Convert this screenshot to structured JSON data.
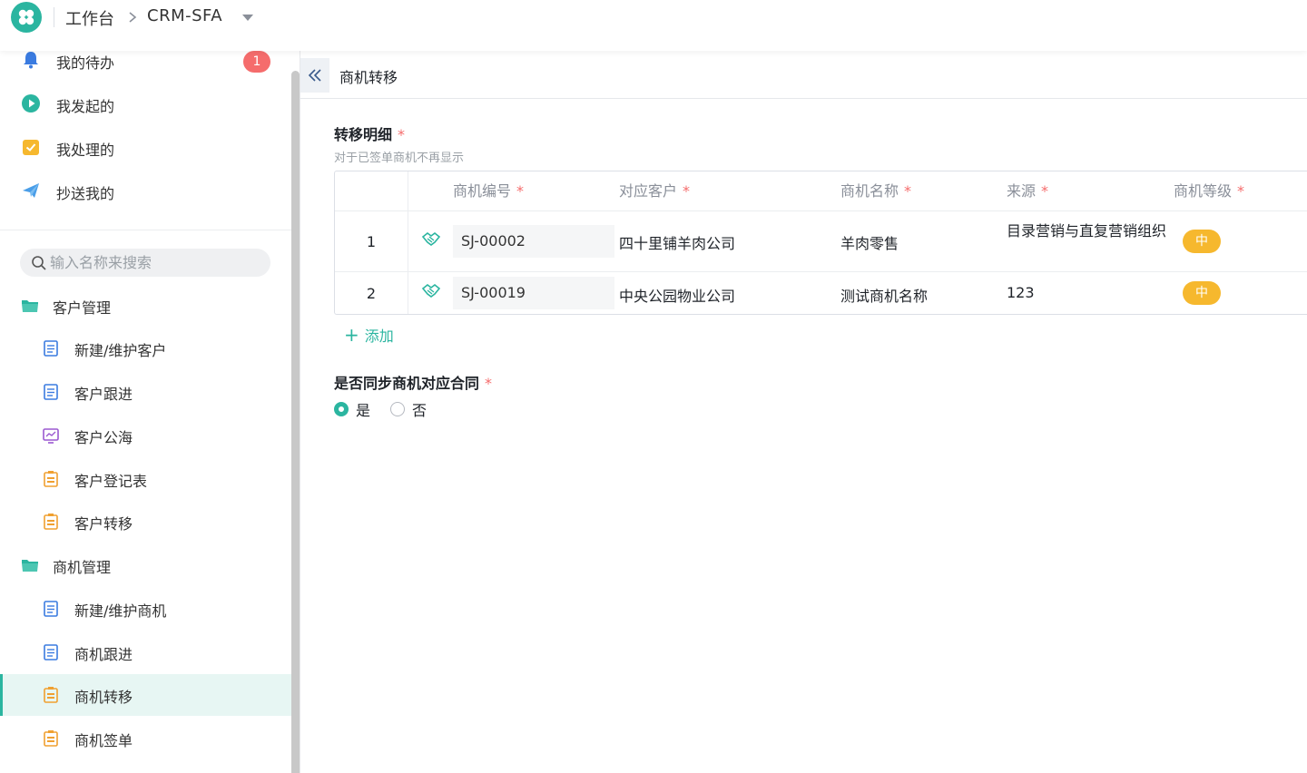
{
  "topbar": {
    "home_label": "工作台",
    "app_label": "CRM-SFA"
  },
  "sidebar": {
    "quick": [
      {
        "label": "我的待办",
        "icon": "bell-icon",
        "badge": "1"
      },
      {
        "label": "我发起的",
        "icon": "play-circle-icon"
      },
      {
        "label": "我处理的",
        "icon": "checklist-icon"
      },
      {
        "label": "抄送我的",
        "icon": "paper-plane-icon"
      }
    ],
    "search_placeholder": "输入名称来搜索",
    "groups": [
      {
        "label": "客户管理",
        "items": [
          {
            "label": "新建/维护客户",
            "icon": "form-icon"
          },
          {
            "label": "客户跟进",
            "icon": "form-icon"
          },
          {
            "label": "客户公海",
            "icon": "dashboard-icon"
          },
          {
            "label": "客户登记表",
            "icon": "report-icon"
          },
          {
            "label": "客户转移",
            "icon": "report-icon"
          }
        ]
      },
      {
        "label": "商机管理",
        "items": [
          {
            "label": "新建/维护商机",
            "icon": "form-icon"
          },
          {
            "label": "商机跟进",
            "icon": "form-icon"
          },
          {
            "label": "商机转移",
            "icon": "report-icon",
            "active": true
          },
          {
            "label": "商机签单",
            "icon": "report-icon"
          }
        ]
      }
    ]
  },
  "main": {
    "title": "商机转移",
    "detail": {
      "label": "转移明细",
      "required_mark": "*",
      "hint": "对于已签单商机不再显示",
      "columns": [
        "商机编号",
        "对应客户",
        "商机名称",
        "来源",
        "商机等级"
      ],
      "rows": [
        {
          "index": "1",
          "code": "SJ-00002",
          "customer": "四十里铺羊肉公司",
          "name": "羊肉零售",
          "source": "目录营销与直复营销组织",
          "level": "中"
        },
        {
          "index": "2",
          "code": "SJ-00019",
          "customer": "中央公园物业公司",
          "name": "测试商机名称",
          "source": "123",
          "level": "中"
        }
      ],
      "add_label": "添加"
    },
    "sync": {
      "label": "是否同步商机对应合同",
      "required_mark": "*",
      "options": [
        "是",
        "否"
      ],
      "selected": "是"
    }
  },
  "colors": {
    "accent": "#2bb5a0",
    "badge": "#f56c6c",
    "level_tag": "#f6b82e",
    "required": "#f56c6c"
  }
}
